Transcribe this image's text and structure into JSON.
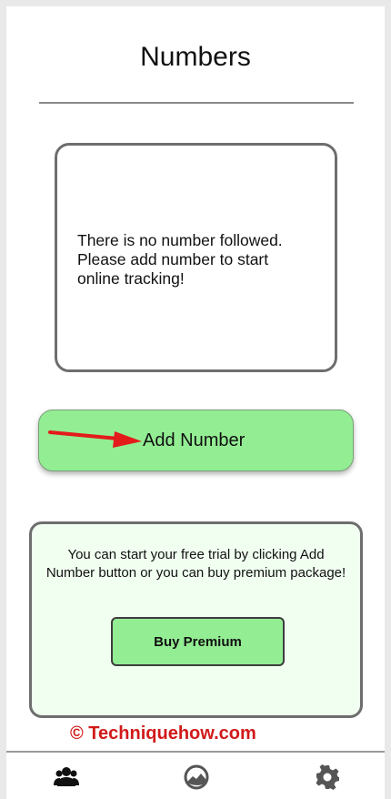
{
  "header": {
    "title": "Numbers"
  },
  "empty_state": {
    "message": "There is no number followed. Please add number to start online tracking!"
  },
  "add_number": {
    "label": "Add Number"
  },
  "promo": {
    "message": "You can start your free trial by clicking Add Number button or you can buy premium package!",
    "premium_label": "Buy Premium"
  },
  "watermark": {
    "text": "© Techniquehow.com"
  },
  "bottom_nav": {
    "items": [
      {
        "icon": "users-icon",
        "active": true
      },
      {
        "icon": "tracking-icon",
        "active": false
      },
      {
        "icon": "gear-icon",
        "active": false
      }
    ]
  },
  "colors": {
    "button_green": "#93ed93",
    "promo_background": "#f1fff1",
    "watermark_red": "#d11a1a",
    "annotation_arrow": "#e31b1b",
    "border_gray": "#6e6e6e"
  }
}
